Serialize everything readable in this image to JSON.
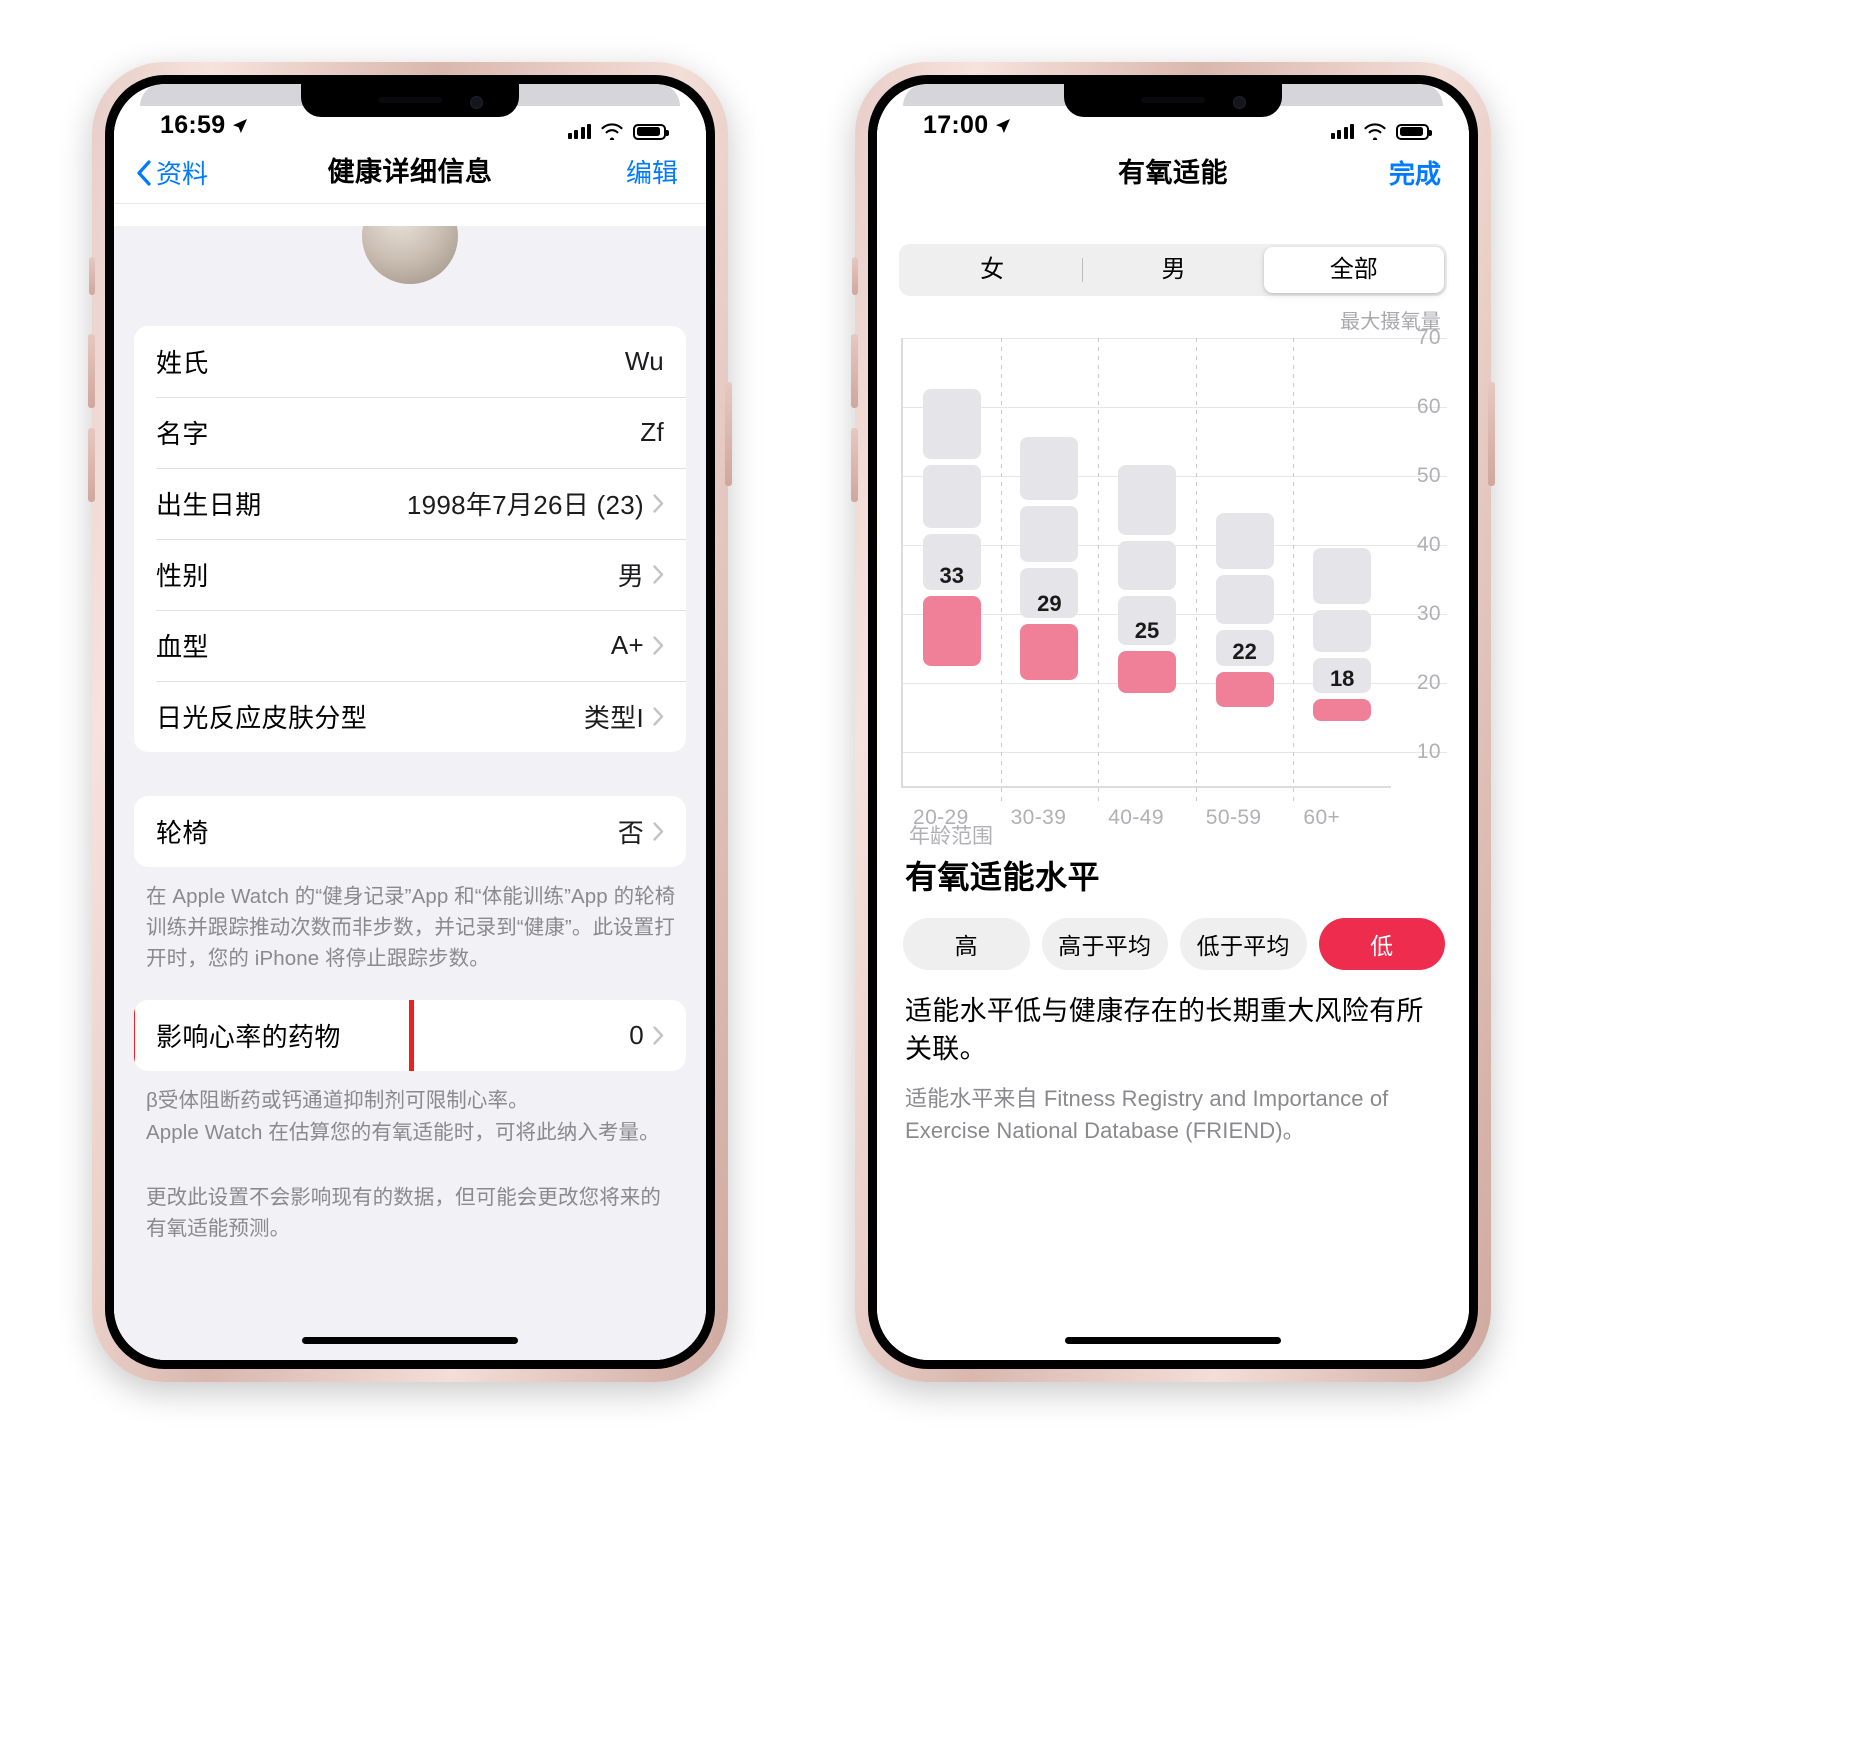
{
  "left_phone": {
    "status_bar": {
      "time": "16:59",
      "location_icon": "location-arrow-icon",
      "cellular_icon": "cellular-bars-icon",
      "wifi_icon": "wifi-icon",
      "battery_icon": "battery-icon"
    },
    "nav": {
      "back_label": "资料",
      "back_icon": "chevron-left-icon",
      "title": "健康详细信息",
      "action_label": "编辑"
    },
    "group1": [
      {
        "label": "姓氏",
        "value": "Wu",
        "chevron": false
      },
      {
        "label": "名字",
        "value": "Zf",
        "chevron": false
      },
      {
        "label": "出生日期",
        "value": "1998年7月26日 (23)",
        "chevron": true
      },
      {
        "label": "性别",
        "value": "男",
        "chevron": true
      },
      {
        "label": "血型",
        "value": "A+",
        "chevron": true
      },
      {
        "label": "日光反应皮肤分型",
        "value": "类型I",
        "chevron": true
      }
    ],
    "group2": [
      {
        "label": "轮椅",
        "value": "否",
        "chevron": true
      }
    ],
    "footnote1": "在 Apple Watch 的“健身记录”App 和“体能训练”App 的轮椅训练并跟踪推动次数而非步数，并记录到“健康”。此设置打开时，您的 iPhone 将停止跟踪步数。",
    "group3": [
      {
        "label": "影响心率的药物",
        "value": "0",
        "chevron": true
      }
    ],
    "footnote2": "β受体阻断药或钙通道抑制剂可限制心率。\nApple Watch 在估算您的有氧适能时，可将此纳入考量。",
    "footnote3": "更改此设置不会影响现有的数据，但可能会更改您将来的有氧适能预测。"
  },
  "right_phone": {
    "status_bar": {
      "time": "17:00",
      "location_icon": "location-arrow-icon",
      "cellular_icon": "cellular-bars-icon",
      "wifi_icon": "wifi-icon",
      "battery_icon": "battery-icon"
    },
    "nav": {
      "title": "有氧适能",
      "action_label": "完成"
    },
    "segmented": {
      "options": [
        "女",
        "男",
        "全部"
      ],
      "selected": "全部"
    },
    "chart_unit_label": "最大摄氧量",
    "section_title": "有氧适能水平",
    "level_pills": {
      "options": [
        "高",
        "高于平均",
        "低于平均",
        "低"
      ],
      "selected": "低",
      "selected_color": "#ee2d4e"
    },
    "description": "适能水平低与健康存在的长期重大风险有所关联。",
    "source_note": "适能水平来自 Fitness Registry and Importance of Exercise National Database (FRIEND)。"
  },
  "chart_data": {
    "type": "bar",
    "title": "有氧适能",
    "subtitle": "最大摄氧量",
    "xlabel": "年龄范围",
    "ylabel": "最大摄氧量",
    "categories": [
      "20-29",
      "30-39",
      "40-49",
      "50-59",
      "60+"
    ],
    "ylim": [
      5,
      70
    ],
    "yticks": [
      70,
      60,
      50,
      40,
      30,
      20,
      10
    ],
    "grid": true,
    "legend": "none",
    "value_labels": [
      33,
      29,
      25,
      22,
      18
    ],
    "series": [
      {
        "name": "高",
        "color": "#e4e4e9",
        "tops": [
          63,
          56,
          52,
          45,
          40
        ],
        "bottoms": [
          52,
          46,
          41,
          36,
          31
        ]
      },
      {
        "name": "高于平均",
        "color": "#e4e4e9",
        "tops": [
          52,
          46,
          41,
          36,
          31
        ],
        "bottoms": [
          42,
          37,
          33,
          28,
          24
        ]
      },
      {
        "name": "低于平均",
        "color": "#e4e4e9",
        "tops": [
          42,
          37,
          33,
          28,
          24
        ],
        "bottoms": [
          33,
          29,
          25,
          22,
          18
        ]
      },
      {
        "name": "低",
        "color": "#f08098",
        "tops": [
          33,
          29,
          25,
          22,
          18
        ],
        "bottoms": [
          22,
          20,
          18,
          16,
          14
        ]
      }
    ]
  }
}
